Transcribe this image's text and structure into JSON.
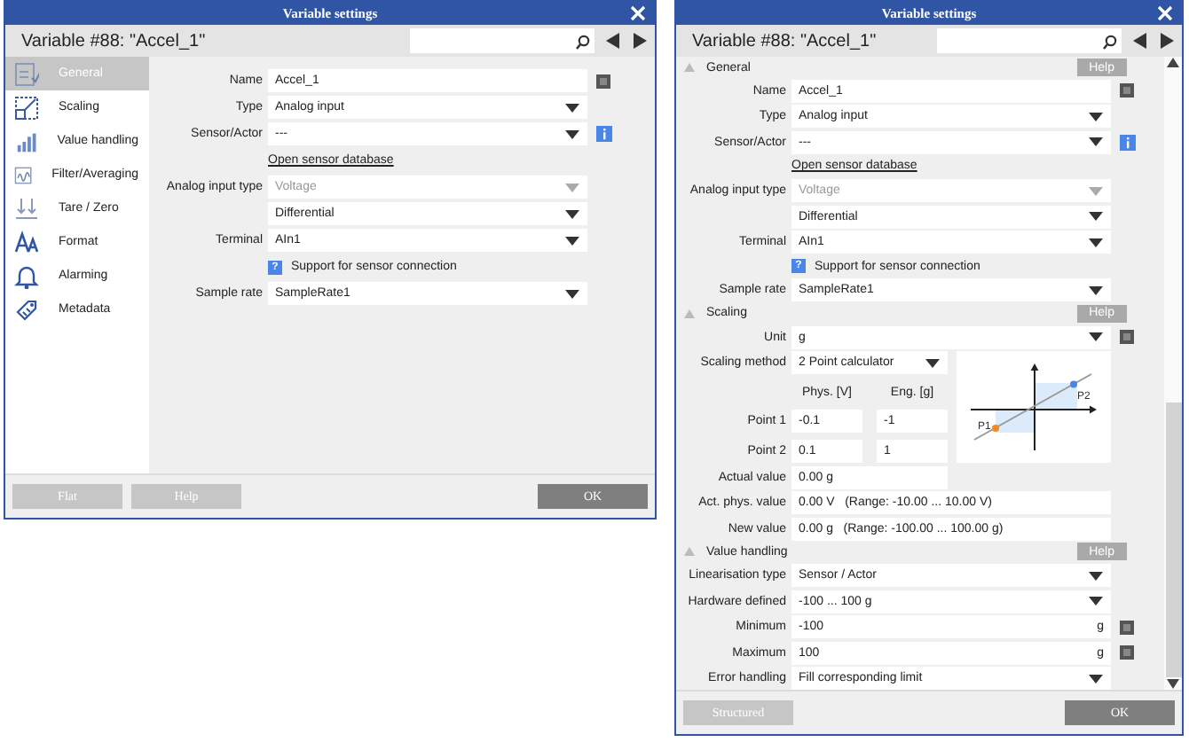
{
  "dialogs": [
    {
      "title": "Variable settings",
      "heading": "Variable #88: \"Accel_1\"",
      "sidebar": [
        {
          "label": "General",
          "selected": true
        },
        {
          "label": "Scaling",
          "selected": false
        },
        {
          "label": "Value handling",
          "selected": false
        },
        {
          "label": "Filter/Averaging",
          "selected": false
        },
        {
          "label": "Tare / Zero",
          "selected": false
        },
        {
          "label": "Format",
          "selected": false
        },
        {
          "label": "Alarming",
          "selected": false
        },
        {
          "label": "Metadata",
          "selected": false
        }
      ],
      "sections": [
        {
          "fields": [
            {
              "kind": "text",
              "label": "Name",
              "value": "Accel_1",
              "options": true,
              "info": false
            },
            {
              "kind": "select",
              "label": "Type",
              "value": "Analog input",
              "disabled": false,
              "options": false,
              "info": false
            },
            {
              "kind": "select",
              "label": "Sensor/Actor",
              "value": "---",
              "disabled": false,
              "options": false,
              "info": true
            },
            {
              "kind": "link",
              "value": "Open sensor database"
            },
            {
              "kind": "select",
              "label": "Analog input type",
              "value": "Voltage",
              "disabled": true,
              "options": false,
              "info": false
            },
            {
              "kind": "select",
              "value": "Differential",
              "disabled": false,
              "options": false,
              "info": false
            },
            {
              "kind": "select",
              "label": "Terminal",
              "value": "AIn1",
              "disabled": false,
              "options": false,
              "info": false
            },
            {
              "kind": "note",
              "icon": "?",
              "value": "Support for sensor connection"
            },
            {
              "kind": "select",
              "label": "Sample rate",
              "value": "SampleRate1",
              "disabled": false,
              "options": false,
              "info": false
            }
          ]
        }
      ],
      "buttons": [
        {
          "label": "Flat",
          "primary": false
        },
        {
          "label": "Help",
          "primary": false
        },
        {
          "label": "OK",
          "primary": true
        }
      ]
    },
    {
      "title": "Variable settings",
      "heading": "Variable #88: \"Accel_1\"",
      "sections": [
        {
          "title": "General",
          "expanded": true,
          "help": "Help",
          "fields": [
            {
              "kind": "text",
              "label": "Name",
              "value": "Accel_1",
              "options": true,
              "info": false
            },
            {
              "kind": "select",
              "label": "Type",
              "value": "Analog input",
              "disabled": false,
              "options": false,
              "info": false
            },
            {
              "kind": "select",
              "label": "Sensor/Actor",
              "value": "---",
              "disabled": false,
              "options": false,
              "info": true
            },
            {
              "kind": "link",
              "value": "Open sensor database"
            },
            {
              "kind": "select",
              "label": "Analog input type",
              "value": "Voltage",
              "disabled": true,
              "options": false,
              "info": false
            },
            {
              "kind": "select",
              "value": "Differential",
              "disabled": false,
              "options": false,
              "info": false
            },
            {
              "kind": "select",
              "label": "Terminal",
              "value": "AIn1",
              "disabled": false,
              "options": false,
              "info": false
            },
            {
              "kind": "note",
              "icon": "?",
              "value": "Support for sensor connection"
            },
            {
              "kind": "select",
              "label": "Sample rate",
              "value": "SampleRate1",
              "disabled": false,
              "options": false,
              "info": false
            }
          ]
        },
        {
          "title": "Scaling",
          "expanded": true,
          "help": "Help",
          "fields": [
            {
              "kind": "select",
              "label": "Unit",
              "value": "g",
              "disabled": false,
              "options": true,
              "info": false
            },
            {
              "kind": "scaling",
              "label": "Scaling method",
              "value": "2 Point calculator",
              "columns": [
                "Phys. [V]",
                "Eng. [g]"
              ],
              "points": [
                {
                  "label": "Point 1",
                  "phys": "-0.1",
                  "eng": "-1"
                },
                {
                  "label": "Point 2",
                  "phys": "0.1",
                  "eng": "1"
                }
              ],
              "diagram_labels": [
                "P1",
                "P2"
              ]
            },
            {
              "kind": "short",
              "label": "Actual value",
              "value": "0.00 g",
              "options": false,
              "info": false
            },
            {
              "kind": "text",
              "label": "Act. phys. value",
              "value": "0.00 V   (Range: -10.00 ... 10.00 V)",
              "options": false,
              "info": false
            },
            {
              "kind": "text",
              "label": "New value",
              "value": "0.00 g   (Range: -100.00 ... 100.00 g)",
              "options": false,
              "info": false
            }
          ]
        },
        {
          "title": "Value handling",
          "expanded": true,
          "help": "Help",
          "fields": [
            {
              "kind": "select",
              "label": "Linearisation type",
              "value": "Sensor / Actor",
              "disabled": false,
              "options": false,
              "info": false
            },
            {
              "kind": "select",
              "label": "Hardware defined",
              "value": "-100 ... 100 g",
              "disabled": false,
              "options": false,
              "info": false
            },
            {
              "kind": "text",
              "label": "Minimum",
              "value": "-100",
              "unit": "g",
              "options": true,
              "info": false
            },
            {
              "kind": "text",
              "label": "Maximum",
              "value": "100",
              "unit": "g",
              "options": true,
              "info": false
            },
            {
              "kind": "select",
              "label": "Error handling",
              "value": "Fill corresponding limit",
              "disabled": false,
              "options": false,
              "info": false
            }
          ]
        }
      ],
      "buttons": [
        {
          "label": "Structured",
          "primary": false
        },
        {
          "label": "OK",
          "primary": true
        }
      ]
    }
  ]
}
